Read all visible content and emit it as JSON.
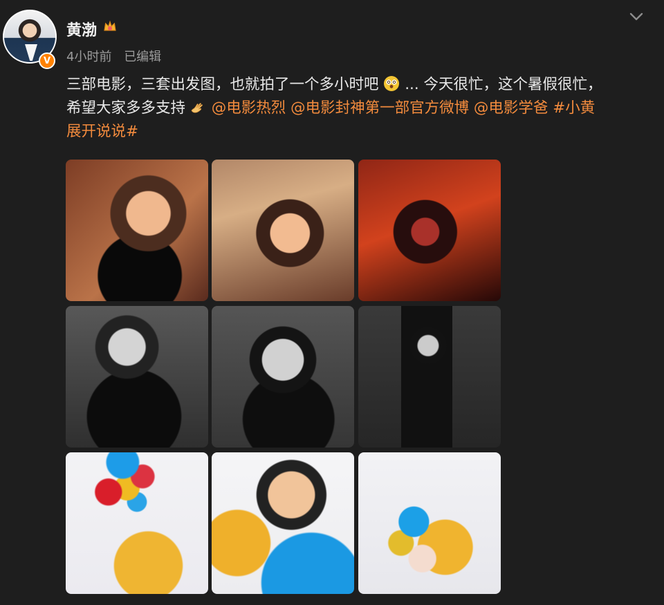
{
  "post": {
    "author": "黄渤",
    "time": "4小时前",
    "edited": "已编辑",
    "text": {
      "line_parts": [
        "三部电影，三套出发图，也就拍了一个多小时吧",
        "... 今天很忙，这个暑假很忙，",
        "希望大家多多支持",
        " ",
        "@电影热烈",
        " ",
        "@电影封神第一部官方微博",
        " ",
        "@电影学爸",
        " ",
        "#小黄",
        "展开说说#"
      ]
    }
  },
  "colors": {
    "background": "#1e1e1e",
    "text": "#e8e8e8",
    "muted": "#9b9b9b",
    "link": "#f38b3d",
    "verified": "#ff8200"
  },
  "icons": {
    "crown": "crown-icon",
    "chevron": "chevron-down-icon",
    "emoji_1": "dizzy-face-icon",
    "emoji_2": "clapping-hands-icon"
  }
}
